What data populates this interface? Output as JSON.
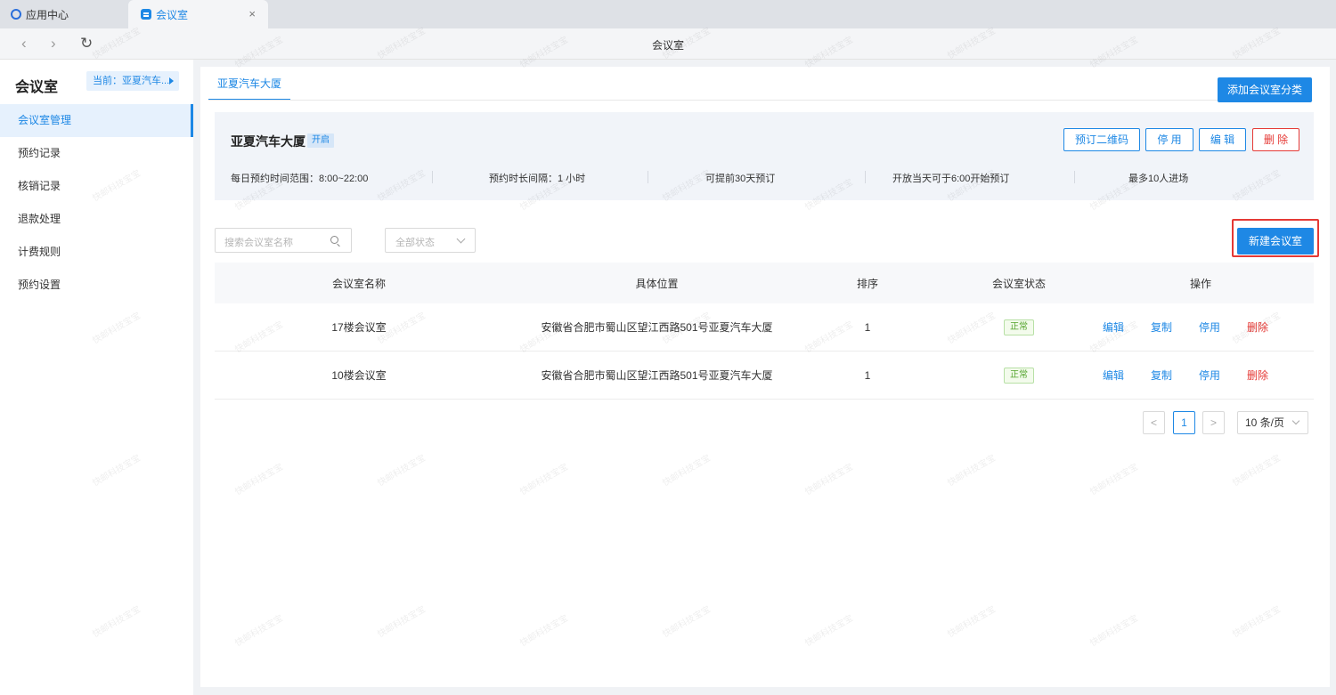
{
  "tabs": [
    {
      "label": "应用中心"
    },
    {
      "label": "会议室"
    }
  ],
  "nav": {
    "title": "会议室"
  },
  "sidebar": {
    "title": "会议室",
    "current": "当前：亚夏汽车...",
    "items": [
      {
        "label": "会议室管理"
      },
      {
        "label": "预约记录"
      },
      {
        "label": "核销记录"
      },
      {
        "label": "退款处理"
      },
      {
        "label": "计费规则"
      },
      {
        "label": "预约设置"
      }
    ]
  },
  "main": {
    "building_tab": "亚夏汽车大厦",
    "add_category_label": "添加会议室分类",
    "building": {
      "name": "亚夏汽车大厦",
      "status": "开启",
      "buttons": {
        "qr": "预订二维码",
        "disable": "停 用",
        "edit": "编 辑",
        "delete": "删 除"
      },
      "info": [
        "每日预约时间范围：8:00~22:00",
        "预约时长间隔：1 小时",
        "可提前30天预订",
        "开放当天可于6:00开始预订",
        "最多10人进场"
      ]
    },
    "search": {
      "placeholder": "搜索会议室名称"
    },
    "status_filter": {
      "value": "全部状态"
    },
    "new_room_label": "新建会议室",
    "table": {
      "headers": [
        "会议室名称",
        "具体位置",
        "排序",
        "会议室状态",
        "操作"
      ],
      "rows": [
        {
          "name": "17楼会议室",
          "location": "安徽省合肥市蜀山区望江西路501号亚夏汽车大厦",
          "sort": "1",
          "status": "正常"
        },
        {
          "name": "10楼会议室",
          "location": "安徽省合肥市蜀山区望江西路501号亚夏汽车大厦",
          "sort": "1",
          "status": "正常"
        }
      ],
      "ops": [
        "编辑",
        "复制",
        "停用",
        "删除"
      ]
    },
    "pager": {
      "prev": "<",
      "page": "1",
      "next": ">",
      "size": "10 条/页"
    }
  },
  "watermark": "快邮科技宝宝",
  "colors": {
    "accent": "#1e88e5",
    "danger": "#e53935",
    "success": "#52a32a"
  }
}
